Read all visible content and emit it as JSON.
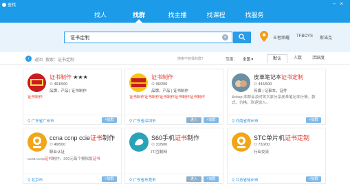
{
  "app": {
    "title": "查找"
  },
  "nav": [
    "找人",
    "找群",
    "找主播",
    "找课程",
    "找服务"
  ],
  "search": {
    "value": "证书定制",
    "hot_tags": [
      "王者荣耀",
      "TFBOYS",
      "斯诺克"
    ]
  },
  "filter": {
    "back_label": "返回",
    "breadcrumb": "搜索：证书定制",
    "hint": "搜索不到我的群？",
    "scope_label": "范围：",
    "scope_value": "全国",
    "sorts": [
      "默认",
      "人数",
      "活跃度"
    ]
  },
  "groups": [
    {
      "name_hl": "证书制作",
      "name_rest": " ★★★",
      "count": "491/500",
      "tags": "品牌，产品 | 证书制作",
      "desc": "证书制作",
      "location": "广东省广州市",
      "buttons": [
        "+加群"
      ],
      "avatar_color": "#c91c1c"
    },
    {
      "name_hl": "证书制作",
      "name_rest": "",
      "count": "96/200",
      "tags": "品牌，产品 | 证书制作",
      "desc": "证书制作证书制作证书制作证书制作证书制作",
      "location": "广东省深圳市",
      "buttons": [
        "进入",
        "+加群"
      ],
      "avatar_color": "#f5c518"
    },
    {
      "name_pre": "皮革笔记本",
      "name_hl": "证书定制",
      "name_rest": "",
      "count": "446/500",
      "tags": "传媒 | 记事本，证件",
      "desc": "&nbsp;本群会及时将大家分享皮革笔记本行情，款式，价格，欢迎加入。",
      "location": "河南省郑州市",
      "buttons": [
        "+加群"
      ],
      "avatar_color": "#6b8fa3"
    },
    {
      "name_pre": "ccna ccnp ccie",
      "name_hl": "证书",
      "name_rest": "制作",
      "count": "49/500",
      "tags": "职业认证",
      "desc_pre": "ccna ccnp",
      "desc_hl": "证书",
      "desc_mid": "制作，200元每个模拟版",
      "desc_hl2": "证书",
      "location": "北京市",
      "buttons": [
        "+加群"
      ],
      "avatar_color": "#f2a516"
    },
    {
      "name_pre": "S60手机",
      "name_hl": "证书",
      "name_rest": "制作",
      "count": "31/500",
      "tags": "IT/互联网",
      "desc": "",
      "location": "广东省东莞市",
      "buttons": [
        "进入",
        "+加群"
      ],
      "avatar_color": "#2aa3b8"
    },
    {
      "name_pre": "STC单片机",
      "name_hl": "证书定制",
      "name_rest": "",
      "count": "73/200",
      "tags": "行业交流",
      "desc": "",
      "location": "江苏省徐州市",
      "buttons": [
        "+加群"
      ],
      "avatar_color": "#f2a516"
    }
  ],
  "colors": {
    "accent": "#1c9be8",
    "highlight": "#e23b2e",
    "location": "#2a8fd6"
  }
}
